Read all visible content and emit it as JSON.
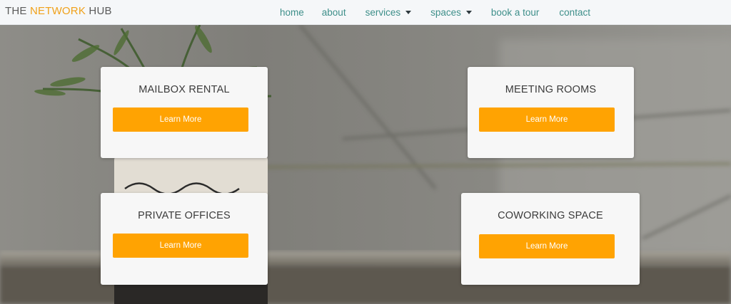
{
  "brand": {
    "part1": "THE ",
    "highlight": "NETWORK",
    "part2": " HUB",
    "highlight_color": "#f0a11a"
  },
  "nav": {
    "items": [
      {
        "label": "home",
        "dropdown": false
      },
      {
        "label": "about",
        "dropdown": false
      },
      {
        "label": "services",
        "dropdown": true
      },
      {
        "label": "spaces",
        "dropdown": true
      },
      {
        "label": "book a tour",
        "dropdown": false
      },
      {
        "label": "contact",
        "dropdown": false
      }
    ],
    "link_color": "#3e8f8a"
  },
  "cards": [
    {
      "title": "MAILBOX RENTAL",
      "button": "Learn More"
    },
    {
      "title": "MEETING ROOMS",
      "button": "Learn More"
    },
    {
      "title": "PRIVATE OFFICES",
      "button": "Learn More"
    },
    {
      "title": "COWORKING SPACE",
      "button": "Learn More"
    }
  ],
  "colors": {
    "accent": "#ffa302",
    "card_bg": "#f7f7f7",
    "navbar_bg": "#f5f7f9"
  }
}
